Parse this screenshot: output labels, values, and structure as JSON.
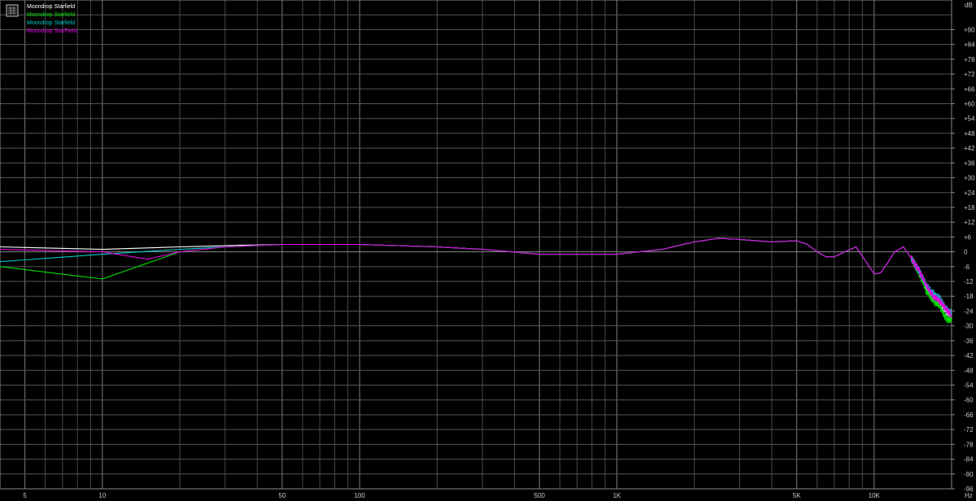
{
  "chart_data": {
    "type": "line",
    "xscale": "log",
    "xlim": [
      4,
      20000
    ],
    "ylim": [
      -96,
      96
    ],
    "grid": true,
    "legend_position": "top-left",
    "ylabel": "dB",
    "xlabel": "Hz",
    "x_ticks": [
      {
        "v": 5,
        "label": "5"
      },
      {
        "v": 10,
        "label": "10"
      },
      {
        "v": 50,
        "label": "50"
      },
      {
        "v": 100,
        "label": "100"
      },
      {
        "v": 500,
        "label": "500"
      },
      {
        "v": 1000,
        "label": "1K"
      },
      {
        "v": 5000,
        "label": "5K"
      },
      {
        "v": 10000,
        "label": "10K"
      }
    ],
    "y_ticks": [
      "+90",
      "+84",
      "+78",
      "+72",
      "+66",
      "+60",
      "+54",
      "+48",
      "+42",
      "+36",
      "+30",
      "+24",
      "+18",
      "+12",
      "+6",
      "0",
      "-6",
      "-12",
      "-18",
      "-24",
      "-30",
      "-36",
      "-42",
      "-48",
      "-54",
      "-60",
      "-66",
      "-72",
      "-78",
      "-84",
      "-90",
      "-96"
    ],
    "series": [
      {
        "name": "Moondrop Starfield",
        "color": "#ffffff",
        "x": [
          4,
          10,
          20,
          30,
          50,
          70,
          100,
          200,
          300,
          500,
          700,
          1000,
          1500,
          2000,
          2500,
          3000,
          4000,
          5000,
          5500,
          6000,
          6500,
          7000,
          7700,
          8500,
          9300,
          10000,
          10600,
          11200,
          12000,
          13000,
          14000,
          15000,
          16000,
          17000,
          18000,
          19000,
          20000
        ],
        "y": [
          2,
          1,
          2,
          2.5,
          3,
          3,
          3,
          2,
          1,
          -1,
          -1,
          -1,
          1,
          4,
          5.5,
          5,
          4,
          4.5,
          3,
          0,
          -2,
          -2,
          0,
          2,
          -4,
          -9,
          -8.5,
          -5,
          0,
          2,
          -3,
          -8,
          -15,
          -18,
          -20,
          -24,
          -26
        ]
      },
      {
        "name": "Moondrop Starfield",
        "color": "#00e000",
        "x": [
          4,
          10,
          20,
          30,
          50,
          70,
          100,
          200,
          300,
          500,
          700,
          1000,
          1500,
          2000,
          2500,
          3000,
          4000,
          5000,
          5500,
          6000,
          6500,
          7000,
          7700,
          8500,
          9300,
          10000,
          10600,
          11200,
          12000,
          13000,
          14000,
          15000,
          16000,
          17000,
          18000,
          19000,
          20000
        ],
        "y": [
          -6,
          -11,
          0,
          2,
          3,
          3,
          3,
          2,
          1,
          -1,
          -1,
          -1,
          1,
          4,
          5.5,
          5,
          4,
          4.5,
          3,
          0,
          -2,
          -2,
          0,
          2,
          -4,
          -9,
          -8.5,
          -5,
          0,
          2,
          -3,
          -9,
          -16,
          -20,
          -22,
          -27,
          -28
        ]
      },
      {
        "name": "Moondrop Starfield",
        "color": "#00c8c8",
        "x": [
          4,
          10,
          20,
          30,
          50,
          70,
          100,
          200,
          300,
          500,
          700,
          1000,
          1500,
          2000,
          2500,
          3000,
          4000,
          5000,
          5500,
          6000,
          6500,
          7000,
          7700,
          8500,
          9300,
          10000,
          10600,
          11200,
          12000,
          13000,
          14000,
          15000,
          16000,
          17000,
          18000,
          19000,
          20000
        ],
        "y": [
          -4,
          -1,
          1,
          2,
          3,
          3,
          3,
          2,
          1,
          -1,
          -1,
          -1,
          1,
          4,
          5.5,
          5,
          4,
          4.5,
          3,
          0,
          -2,
          -2,
          0,
          2,
          -4,
          -9,
          -8.5,
          -5,
          0,
          2,
          -3,
          -8,
          -14,
          -17,
          -19,
          -23,
          -25
        ]
      },
      {
        "name": "Moondrop StarField",
        "color": "#e000e0",
        "x": [
          4,
          10,
          15,
          20,
          30,
          50,
          70,
          100,
          200,
          300,
          500,
          700,
          1000,
          1500,
          2000,
          2500,
          3000,
          4000,
          5000,
          5500,
          6000,
          6500,
          7000,
          7700,
          8500,
          9300,
          10000,
          10600,
          11200,
          12000,
          13000,
          14000,
          15000,
          16000,
          17000,
          18000,
          19000,
          20000
        ],
        "y": [
          1,
          0,
          -3,
          0,
          2,
          3,
          3,
          3,
          2,
          1,
          -1,
          -1,
          -1,
          1,
          4,
          5.5,
          5,
          4,
          4.5,
          3,
          0,
          -2,
          -2,
          0,
          2,
          -4,
          -9,
          -8.5,
          -5,
          0,
          2,
          -3,
          -8,
          -14,
          -18,
          -20,
          -23,
          -26
        ]
      }
    ]
  }
}
